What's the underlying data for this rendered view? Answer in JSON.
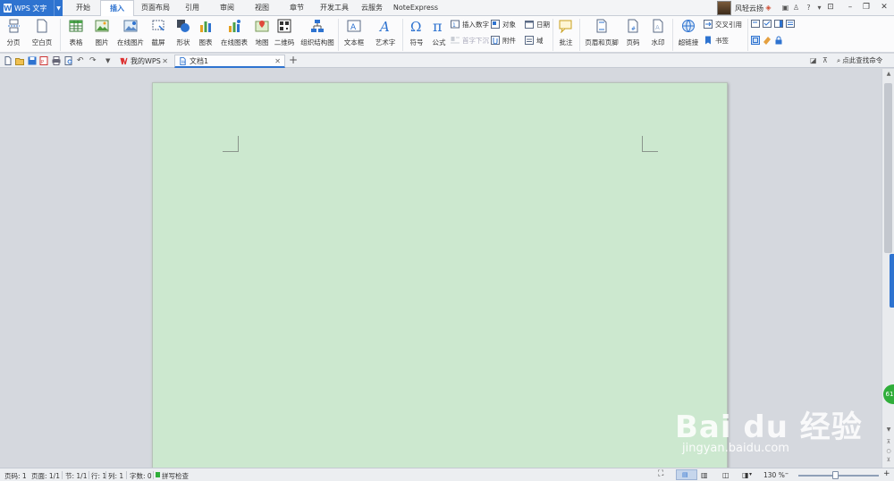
{
  "app": {
    "name": "WPS 文字",
    "logo_letter": "W"
  },
  "menu": {
    "tabs": [
      "开始",
      "插入",
      "页面布局",
      "引用",
      "审阅",
      "视图",
      "章节",
      "开发工具",
      "云服务",
      "NoteExpress"
    ],
    "active": "插入"
  },
  "user": {
    "name": "风轻云扬"
  },
  "ribbon": {
    "large": [
      "分页",
      "空白页",
      "表格",
      "图片",
      "在线图片",
      "截屏",
      "形状",
      "图表",
      "在线图表",
      "地图",
      "二维码",
      "组织结构图",
      "文本框",
      "艺术字",
      "符号",
      "公式",
      "批注",
      "页眉和页脚",
      "页码",
      "水印",
      "超链接"
    ],
    "small": {
      "insert_number": "插入数字",
      "first_drop": "首字下沉",
      "object": "对象",
      "attachment": "附件",
      "date": "日期",
      "field": "域",
      "cross_ref": "交叉引用",
      "bookmark": "书签"
    }
  },
  "doc_tabs": [
    {
      "label": "我的WPS",
      "active": false
    },
    {
      "label": "文档1",
      "active": true
    }
  ],
  "find_command": "点此查找命令",
  "status": {
    "page": "页码: 1",
    "pages": "页面: 1/1",
    "section": "节: 1/1",
    "row": "行: 1",
    "col": "列: 1",
    "words": "字数: 0",
    "spell": "拼写检查",
    "zoom": "130 %",
    "zoom_percent": 130
  },
  "watermark": {
    "brand": "Bai du 经验",
    "url": "jingyan.baidu.com"
  },
  "side_badge": "61",
  "colors": {
    "accent": "#2e73d0",
    "page": "#cce8cf",
    "workspace": "#d5d8de"
  }
}
